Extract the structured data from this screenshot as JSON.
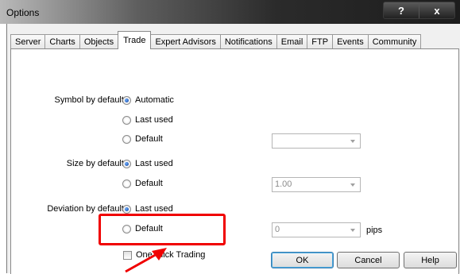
{
  "window": {
    "title": "Options",
    "help_glyph": "?",
    "close_glyph": "x"
  },
  "tabs": [
    {
      "label": "Server"
    },
    {
      "label": "Charts"
    },
    {
      "label": "Objects"
    },
    {
      "label": "Trade"
    },
    {
      "label": "Expert Advisors"
    },
    {
      "label": "Notifications"
    },
    {
      "label": "Email"
    },
    {
      "label": "FTP"
    },
    {
      "label": "Events"
    },
    {
      "label": "Community"
    }
  ],
  "active_tab": "Trade",
  "symbol": {
    "label": "Symbol by default:",
    "automatic": "Automatic",
    "last_used": "Last used",
    "default": "Default",
    "selected": "Automatic",
    "combo_value": ""
  },
  "size": {
    "label": "Size by default:",
    "last_used": "Last used",
    "default": "Default",
    "selected": "Last used",
    "combo_value": "1.00"
  },
  "deviation": {
    "label": "Deviation by default:",
    "last_used": "Last used",
    "default": "Default",
    "selected": "Last used",
    "combo_value": "0",
    "unit": "pips"
  },
  "one_click": {
    "label": "One Click Trading",
    "checked": false
  },
  "buttons": {
    "ok": "OK",
    "cancel": "Cancel",
    "help": "Help"
  },
  "colors": {
    "highlight": "#f00000"
  }
}
